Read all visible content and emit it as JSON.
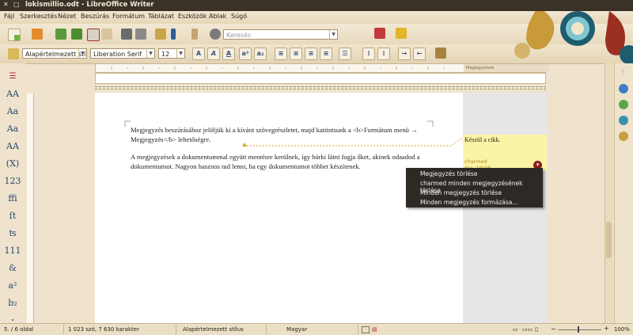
{
  "window": {
    "title": "lokismillio.odt - LibreOffice Writer"
  },
  "menu": [
    "Fájl",
    "Szerkesztés",
    "Nézet",
    "Beszúrás",
    "Formátum",
    "Táblázat",
    "Eszközök",
    "Ablak",
    "Súgó"
  ],
  "toolbar": {
    "search_placeholder": "Keresés",
    "paragraph_style": "Alapértelmezett stí",
    "font_name": "Liberation Serif",
    "font_size": "12"
  },
  "ruler": {
    "comments_header": "Megjegyzések"
  },
  "document": {
    "para1": "Megjegyzés beszúrásához jelöljük ki a kívánt szövegrészletet, majd kattintsunk a <b>Formátum menü → Megjegyzés</b> lehetőségre.",
    "para2": "A megjegyzések a dokumentummal együtt mentésre kerülnek, így bárki látni fogja őket, akinek odaadod a dokumentumot. Nagyon hasznos tud lenni, ha egy dokumentumot többet készítenek."
  },
  "comment": {
    "text": "Készül a cikk.",
    "author": "charmed",
    "date": "ma, 19:08"
  },
  "context_menu": [
    "Megjegyzés törlése",
    "charmed minden megjegyzésének törlése",
    "Minden megjegyzés törlése",
    "Minden megjegyzés formázása..."
  ],
  "statusbar": {
    "page": "5. / 6 oldal",
    "words": "1 023 szó, 7 630 karakter",
    "style": "Alapértelmezett stílus",
    "language": "Magyar",
    "zoom": "100%"
  },
  "colors": {
    "comment_bg": "#fbf4a6",
    "anchor_line": "#e0a030",
    "menu_bg": "#2d2a26"
  }
}
